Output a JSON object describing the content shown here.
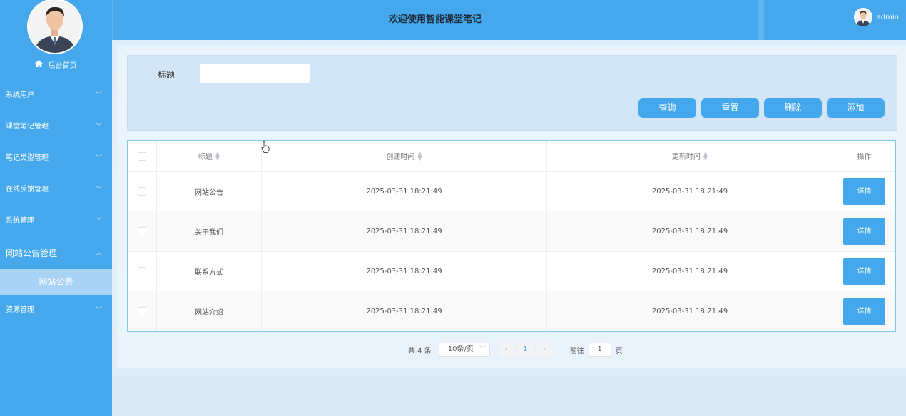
{
  "sidebar": {
    "home_label": "后台首页",
    "home_icon": "home-icon",
    "menu": [
      {
        "label": "系统用户"
      },
      {
        "label": "课堂笔记管理"
      },
      {
        "label": "笔记类型管理"
      },
      {
        "label": "在线反馈管理"
      },
      {
        "label": "系统管理"
      },
      {
        "label": "网站公告管理"
      },
      {
        "label": "资源管理"
      }
    ],
    "submenu_active": "网站公告",
    "chevron_down": "﹀",
    "chevron_up": "︿"
  },
  "header": {
    "title": "欢迎使用智能课堂笔记",
    "username": "admin"
  },
  "search": {
    "label": "标题",
    "value": "",
    "buttons": {
      "query": "查询",
      "reset": "重置",
      "delete": "删除",
      "add": "添加"
    }
  },
  "table": {
    "columns": {
      "title": "标题",
      "created": "创建时间",
      "updated": "更新时间",
      "actions": "操作"
    },
    "rows": [
      {
        "title": "网站公告",
        "created": "2025-03-31 18:21:49",
        "updated": "2025-03-31 18:21:49"
      },
      {
        "title": "关于我们",
        "created": "2025-03-31 18:21:49",
        "updated": "2025-03-31 18:21:49"
      },
      {
        "title": "联系方式",
        "created": "2025-03-31 18:21:49",
        "updated": "2025-03-31 18:21:49"
      },
      {
        "title": "网站介绍",
        "created": "2025-03-31 18:21:49",
        "updated": "2025-03-31 18:21:49"
      }
    ],
    "detail_label": "详情"
  },
  "pagination": {
    "total": "共 4 条",
    "page_size": "10条/页",
    "current_page": "1",
    "goto_label": "前往",
    "goto_value": "1",
    "page_suffix": "页"
  },
  "colors": {
    "primary": "#45a8ec",
    "active_submenu": "#a9d3f5"
  }
}
